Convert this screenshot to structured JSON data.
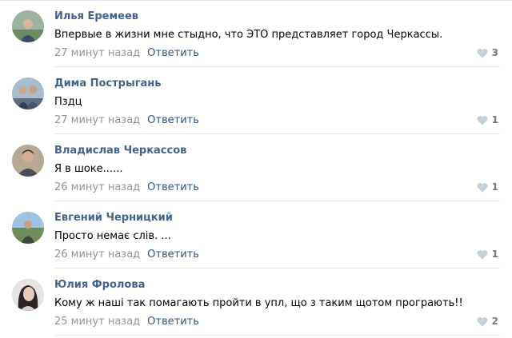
{
  "comments": [
    {
      "author": "Илья Еремеев",
      "text": "Впервые в жизни мне стыдно, что ЭТО представляет город Черкассы.",
      "time": "27 минут назад",
      "reply_label": "Ответить",
      "likes": "3"
    },
    {
      "author": "Дима Пострыгань",
      "text": "Пздц",
      "time": "27 минут назад",
      "reply_label": "Ответить",
      "likes": "1"
    },
    {
      "author": "Владислав Черкассов",
      "text": "Я в шоке......",
      "time": "26 минут назад",
      "reply_label": "Ответить",
      "likes": "1"
    },
    {
      "author": "Евгений Черницкий",
      "text": "Просто немає слів. ...",
      "time": "26 минут назад",
      "reply_label": "Ответить",
      "likes": "1"
    },
    {
      "author": "Юлия Фролова",
      "text": "Кому ж наші так помагають пройти в упл, що з таким щотом програють!!",
      "time": "25 минут назад",
      "reply_label": "Ответить",
      "likes": "2"
    }
  ],
  "icons": {
    "like": "heart-icon"
  },
  "colors": {
    "author": "#42648b",
    "reply": "#2a5885",
    "meta": "#939393",
    "like": "#6f7985",
    "heart": "#c5d0db"
  }
}
